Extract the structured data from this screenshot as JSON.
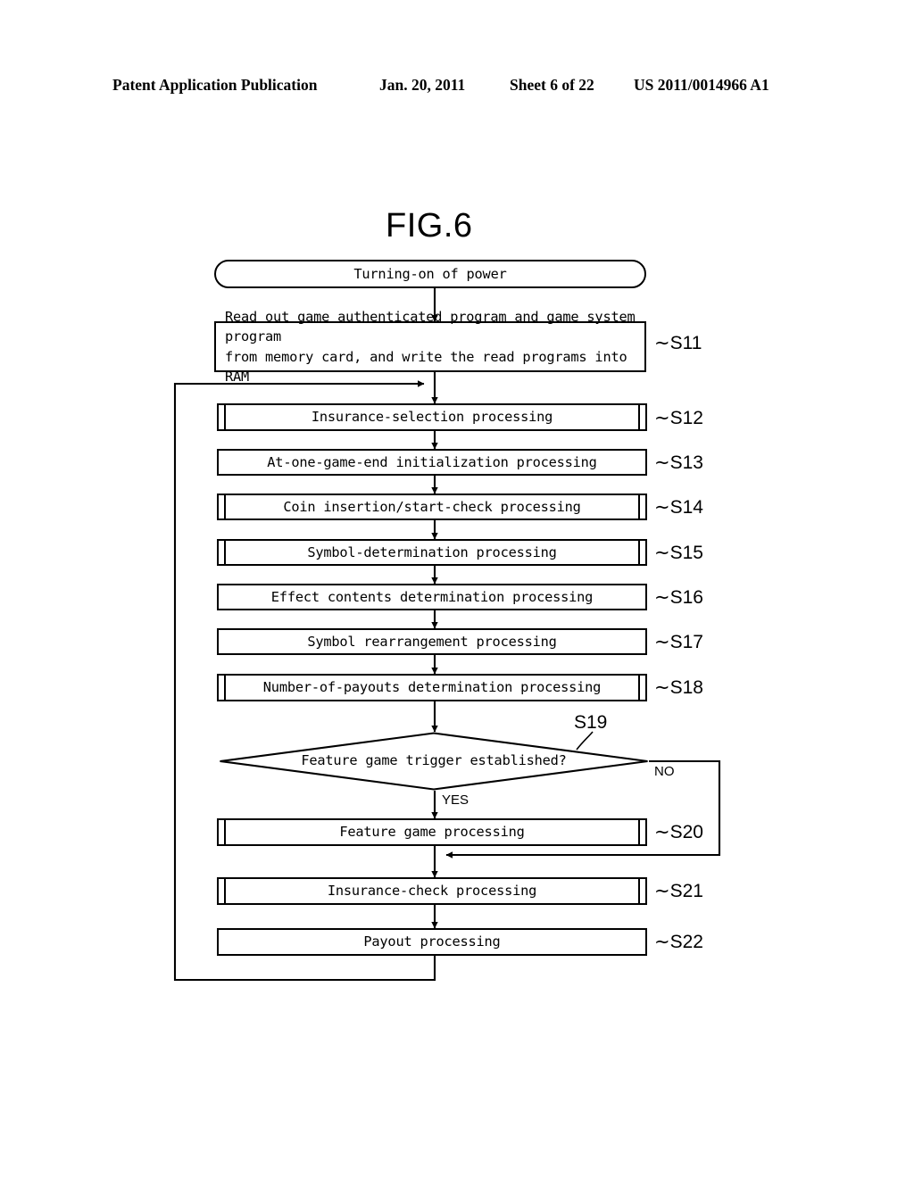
{
  "header": {
    "publication": "Patent Application Publication",
    "date": "Jan. 20, 2011",
    "sheet": "Sheet 6 of 22",
    "number": "US 2011/0014966 A1"
  },
  "figure": {
    "title": "FIG.6"
  },
  "flowchart": {
    "start": {
      "id": "start",
      "shape": "terminal",
      "label": "Turning-on of power"
    },
    "steps": [
      {
        "id": "S11",
        "tag": "S11",
        "shape": "process",
        "label": "Read out game authenticated program and game system program\nfrom memory card, and write the read programs into RAM"
      },
      {
        "id": "S12",
        "tag": "S12",
        "shape": "predefined-process",
        "label": "Insurance-selection processing"
      },
      {
        "id": "S13",
        "tag": "S13",
        "shape": "process",
        "label": "At-one-game-end initialization processing"
      },
      {
        "id": "S14",
        "tag": "S14",
        "shape": "predefined-process",
        "label": "Coin insertion/start-check processing"
      },
      {
        "id": "S15",
        "tag": "S15",
        "shape": "predefined-process",
        "label": "Symbol-determination processing"
      },
      {
        "id": "S16",
        "tag": "S16",
        "shape": "process",
        "label": "Effect contents determination processing"
      },
      {
        "id": "S17",
        "tag": "S17",
        "shape": "process",
        "label": "Symbol rearrangement processing"
      },
      {
        "id": "S18",
        "tag": "S18",
        "shape": "predefined-process",
        "label": "Number-of-payouts determination processing"
      },
      {
        "id": "S19",
        "tag": "S19",
        "shape": "decision",
        "label": "Feature game trigger established?",
        "branch_yes": "YES",
        "branch_no": "NO"
      },
      {
        "id": "S20",
        "tag": "S20",
        "shape": "predefined-process",
        "label": "Feature game processing"
      },
      {
        "id": "S21",
        "tag": "S21",
        "shape": "predefined-process",
        "label": "Insurance-check processing"
      },
      {
        "id": "S22",
        "tag": "S22",
        "shape": "process",
        "label": "Payout processing"
      }
    ]
  }
}
